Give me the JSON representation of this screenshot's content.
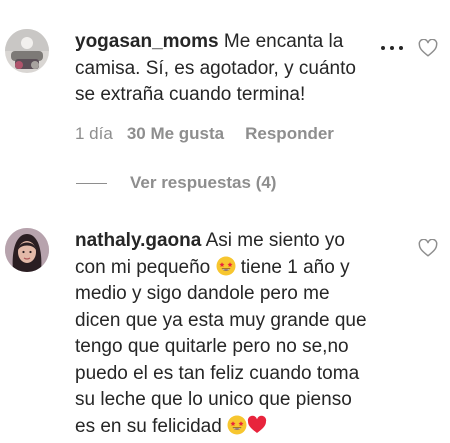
{
  "comments": [
    {
      "username": "yogasan_moms",
      "lines": [
        "Me encanta la",
        "camisa. Sí, es agotador, y cuánto",
        "se extraña cuando termina!"
      ],
      "time": "1 día",
      "likes": "30 Me gusta",
      "reply_label": "Responder",
      "view_replies": "Ver respuestas (4)"
    },
    {
      "username": "nathaly.gaona",
      "lines": [
        "Asi me siento yo",
        "con mi pequeño",
        "tiene 1 año y",
        "medio y sigo dandole pero me",
        "dicen que ya esta muy grande que",
        "tengo que quitarle pero no se,no",
        "puedo el es tan feliz cuando toma",
        "su leche que lo unico que pienso",
        "es en su felicidad"
      ]
    }
  ],
  "colors": {
    "text": "#262626",
    "muted": "#8e8e8e",
    "heart_emoji": "#e8243c"
  },
  "icons": {
    "more": "more-options-icon",
    "like": "heart-outline-icon",
    "emoji_star": "star-struck-emoji",
    "emoji_heart": "red-heart-emoji"
  }
}
